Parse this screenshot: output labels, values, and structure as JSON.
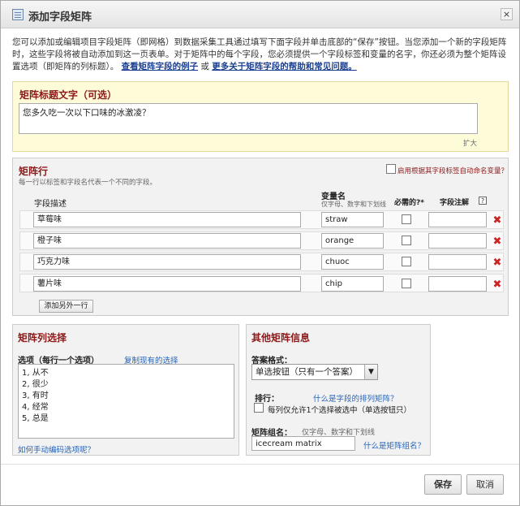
{
  "dialog": {
    "title": "添加字段矩阵",
    "close_label": "×"
  },
  "intro": {
    "text1": "您可以添加或编辑项目字段矩阵（即网格）到数据采集工具通过填写下面字段并单击底部的“保存”按钮。当您添加一个新的字段矩阵时，这些字段将被自动添加到这一页表单。对于矩阵中的每个字段，您必须提供一个字段标签和变量的名字，你还必须为整个矩阵设置选项（即矩阵的列标题）。",
    "link1": "查看矩阵字段的例子",
    "or": " 或 ",
    "link2": "更多关于矩阵字段的帮助和常见问题。"
  },
  "header_section": {
    "title": "矩阵标题文字（可选）",
    "value": "您多久吃一次以下口味的冰激凌？",
    "expand": "扩大"
  },
  "rows_section": {
    "title": "矩阵行",
    "subtitle": "每一行以标签和字段名代表一个不同的字段。",
    "auto_name_label": "启用根据其字段标签自动命名变量？",
    "col_label": "字段描述",
    "col_var": "变量名",
    "col_var_hint": "仅字母、数字和下划线",
    "col_required": "必需的?*",
    "col_note": "字段注解",
    "col_note_help": "?",
    "rows": [
      {
        "label": "草莓味",
        "var": "straw"
      },
      {
        "label": "橙子味",
        "var": "orange"
      },
      {
        "label": "巧克力味",
        "var": "chuoc"
      },
      {
        "label": "薯片味",
        "var": "chip"
      }
    ],
    "add_row": "添加另外一行",
    "delete_icon": "✖"
  },
  "choices_section": {
    "title": "矩阵列选择",
    "label": "选项（每行一个选项）",
    "copy_link": "复制现有的选择",
    "choices": [
      "1, 从不",
      "2, 很少",
      "3, 有时",
      "4, 经常",
      "5, 总是"
    ],
    "help_link": "如何手动编码选项呢？"
  },
  "other_section": {
    "title": "其他矩阵信息",
    "format_label": "答案格式：",
    "format_value": "单选按钮（只有一个答案）",
    "format_arrow": "▼",
    "rank_label": "排行：",
    "rank_link": "什么是字段的排列矩阵？",
    "rank_checkbox_label": "每列仅允许1个选择被选中（单选按钮只）",
    "group_label": "矩阵组名：",
    "group_hint": "仅字母、数字和下划线",
    "group_value": "icecream matrix",
    "group_link": "什么是矩阵组名？"
  },
  "footer": {
    "save": "保存",
    "cancel": "取消"
  }
}
